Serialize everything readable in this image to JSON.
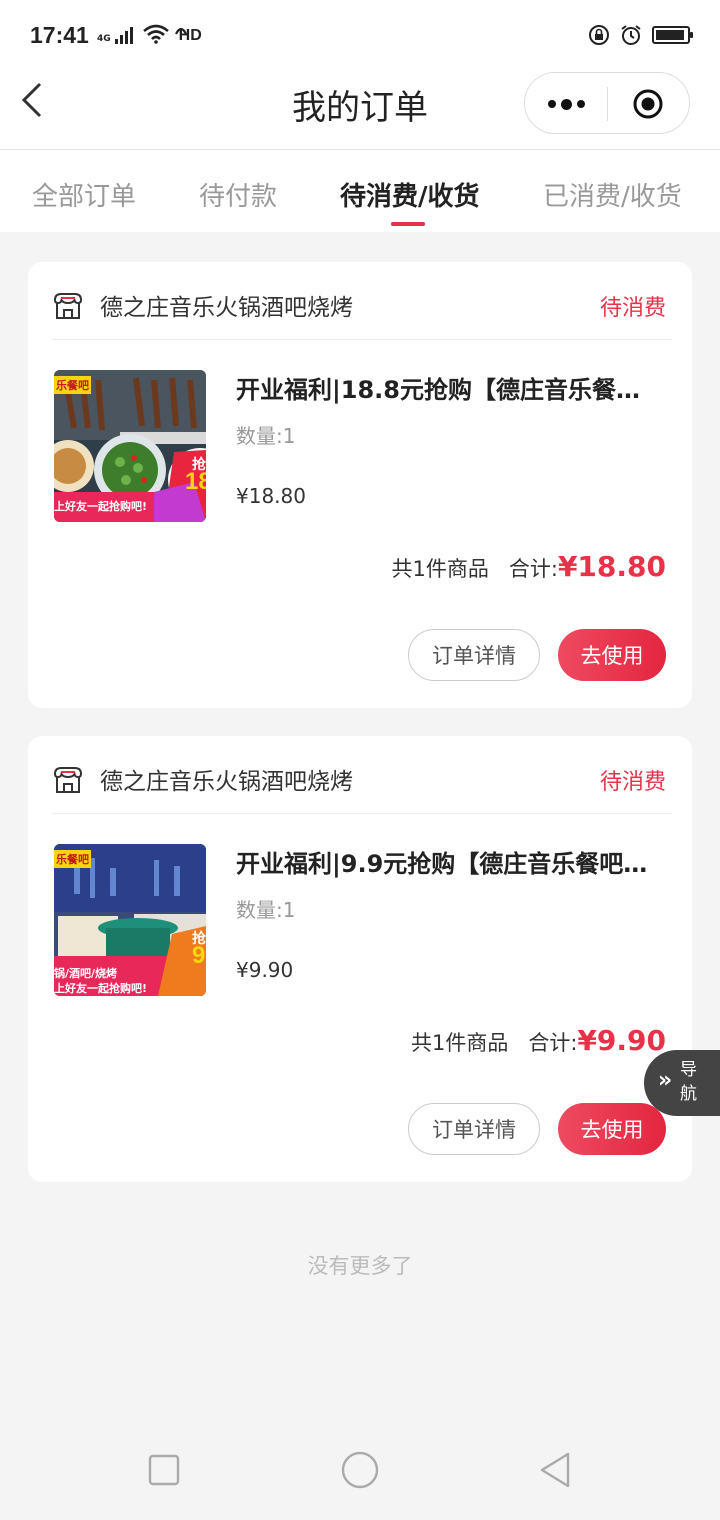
{
  "status_bar": {
    "time": "17:41",
    "network": "4G",
    "hd": "HD",
    "icons": [
      "signal-icon",
      "wifi-icon",
      "hd-call-icon",
      "rotation-lock-icon",
      "alarm-icon",
      "battery-icon"
    ]
  },
  "nav": {
    "title": "我的订单",
    "back_icon": "back-chevron-icon",
    "more_icon": "more-dots-icon",
    "close_icon": "target-circle-icon"
  },
  "tabs": [
    {
      "label": "全部订单",
      "active": false
    },
    {
      "label": "待付款",
      "active": false
    },
    {
      "label": "待消费/收货",
      "active": true
    },
    {
      "label": "已消费/收货",
      "active": false
    }
  ],
  "orders": [
    {
      "shop": "德之庄音乐火锅酒吧烧烤",
      "status": "待消费",
      "title": "开业福利|18.8元抢购【德庄音乐餐…",
      "quantity": "数量:1",
      "unit_price": "¥18.80",
      "item_count": "共1件商品",
      "total_label": "合计:",
      "total": "¥18.80",
      "detail_btn": "订单详情",
      "use_btn": "去使用",
      "thumb_tag": "乐餐吧",
      "thumb_banner": "上好友一起抢购吧!",
      "thumb_big": "18",
      "thumb_side": "抢"
    },
    {
      "shop": "德之庄音乐火锅酒吧烧烤",
      "status": "待消费",
      "title": "开业福利|9.9元抢购【德庄音乐餐吧…",
      "quantity": "数量:1",
      "unit_price": "¥9.90",
      "item_count": "共1件商品",
      "total_label": "合计:",
      "total": "¥9.90",
      "detail_btn": "订单详情",
      "use_btn": "去使用",
      "thumb_tag": "乐餐吧",
      "thumb_banner_top": "锅/酒吧/烧烤",
      "thumb_banner": "上好友一起抢购吧!",
      "thumb_big": "9",
      "thumb_side": "抢"
    }
  ],
  "footer": {
    "no_more": "没有更多了"
  },
  "float_nav": {
    "label": "导航",
    "icon": "double-chevron-icon"
  },
  "system_nav": {
    "icons": [
      "square-recents-icon",
      "circle-home-icon",
      "triangle-back-icon"
    ]
  },
  "colors": {
    "accent": "#e83249",
    "background": "#f4f4f4",
    "muted": "#999999"
  }
}
